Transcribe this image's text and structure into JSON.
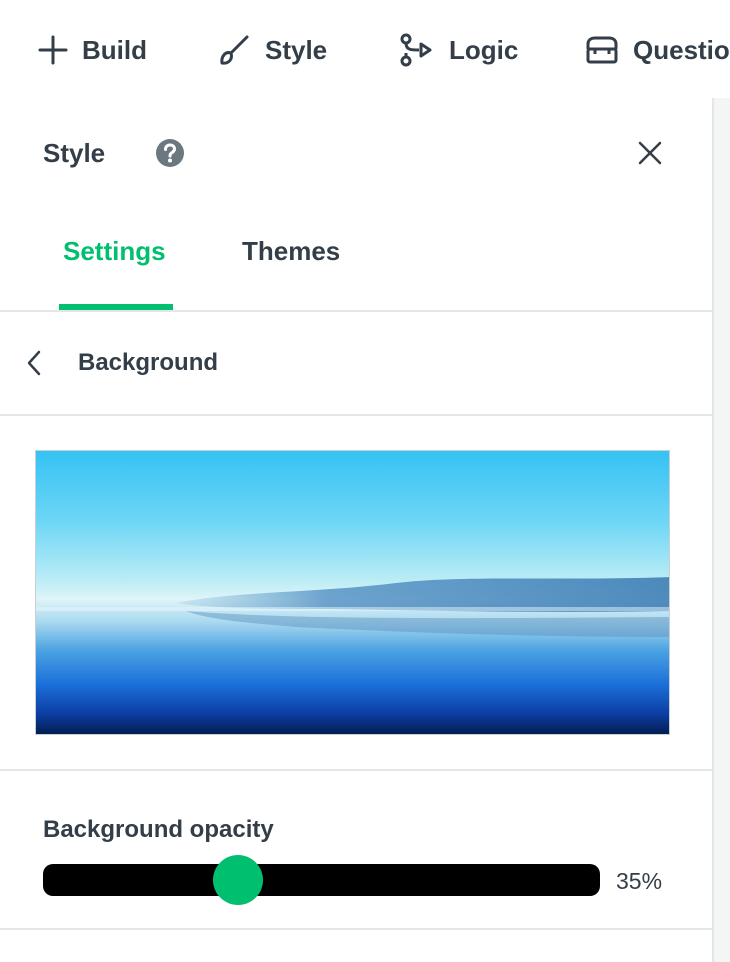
{
  "topnav": {
    "items": [
      {
        "label": "Build",
        "icon": "plus-icon"
      },
      {
        "label": "Style",
        "icon": "brush-icon"
      },
      {
        "label": "Logic",
        "icon": "branch-icon"
      },
      {
        "label": "Questio",
        "icon": "question-bank-icon"
      }
    ]
  },
  "panel": {
    "title": "Style",
    "tabs": [
      {
        "label": "Settings",
        "active": true
      },
      {
        "label": "Themes",
        "active": false
      }
    ],
    "section": {
      "title": "Background"
    },
    "opacity": {
      "label": "Background opacity",
      "value": 35,
      "value_text": "35%"
    }
  },
  "colors": {
    "accent": "#00bf6f",
    "text": "#333e48",
    "divider": "#e3e6e8",
    "slider_track": "#000000"
  }
}
